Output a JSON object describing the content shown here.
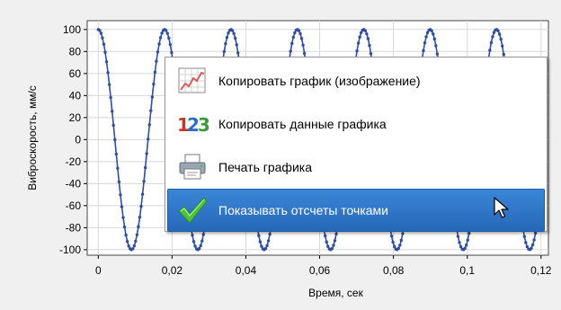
{
  "chart_data": {
    "type": "line",
    "title": "",
    "xlabel": "Время, сек",
    "ylabel": "Виброскорость, мм/с",
    "xlim": [
      -0.003,
      0.122
    ],
    "ylim": [
      -105,
      108
    ],
    "x_ticks": [
      "0",
      "0,02",
      "0,04",
      "0,06",
      "0,08",
      "0,1",
      "0,12"
    ],
    "x_tick_values": [
      0,
      0.02,
      0.04,
      0.06,
      0.08,
      0.1,
      0.12
    ],
    "y_ticks": [
      "100",
      "80",
      "60",
      "40",
      "20",
      "0",
      "-20",
      "-40",
      "-60",
      "-80",
      "-100"
    ],
    "y_tick_values": [
      100,
      80,
      60,
      40,
      20,
      0,
      -20,
      -40,
      -60,
      -80,
      -100
    ],
    "series": [
      {
        "amplitude": 100,
        "frequency_hz": 55.6,
        "phase": "cosine",
        "x_start": 0,
        "x_end": 0.12,
        "marker": "point",
        "color": "#2f4f9e"
      }
    ],
    "grid": true
  },
  "colors": {
    "series": "#2f4f9e",
    "grid": "#d8d8d8",
    "menu_highlight": "#2f74c8"
  },
  "context_menu": {
    "items": [
      {
        "label": "Копировать график (изображение)",
        "icon": "chart-image-icon"
      },
      {
        "label": "Копировать данные графика",
        "icon": "numbers-123-icon"
      },
      {
        "label": "Печать графика",
        "icon": "printer-icon"
      },
      {
        "label": "Показывать отсчеты точками",
        "icon": "checkmark-icon",
        "highlighted": true
      }
    ]
  }
}
